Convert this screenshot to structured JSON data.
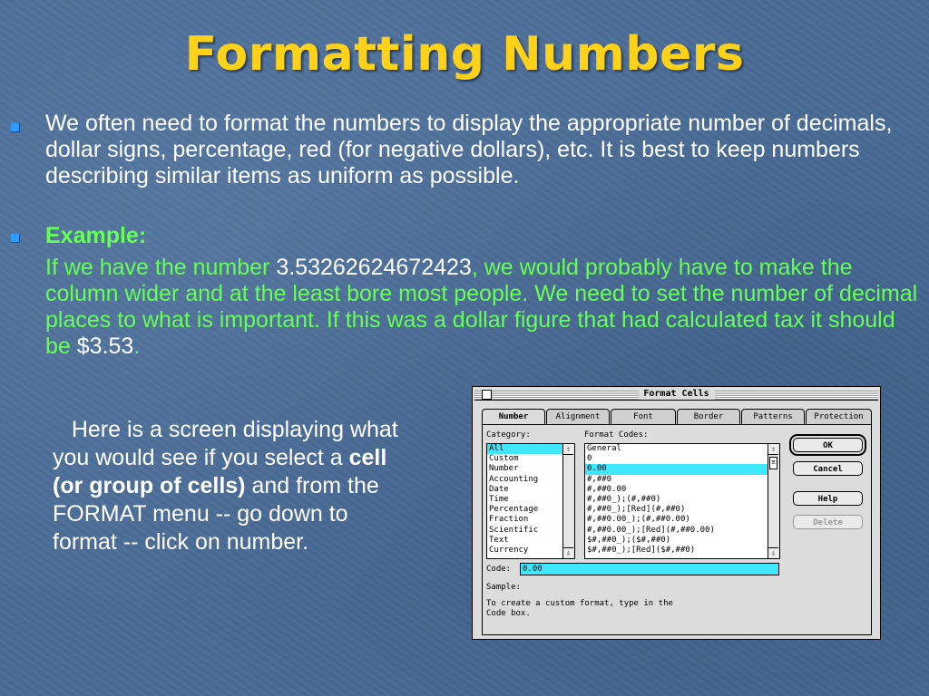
{
  "slide": {
    "title": "Formatting Numbers",
    "bullet1": "We often need to format the numbers to display the appropriate number of decimals, dollar signs, percentage, red (for negative dollars), etc. It is best to keep numbers describing similar items as uniform as possible.",
    "bullet2_heading": "Example:",
    "example": {
      "part1": "If we have the number ",
      "number": "3.53262624672423",
      "part2": ", we would probably have to make the column wider and at the least bore most people. We need to set the number of decimal places to what is important. If this was a dollar figure that had calculated tax it should be ",
      "money": "$3.53",
      "part3": "."
    },
    "caption": {
      "part1": "Here is a screen displaying what you would see if you select a ",
      "bold": "cell (or group of cells)",
      "part2": " and from the FORMAT menu -- go down to format -- click on number."
    },
    "colors": {
      "title": "#ffd21a",
      "green_text": "#66ff55",
      "bullet": "#2f9bff",
      "background": "#4a6c96",
      "highlight": "#3fe8ff"
    }
  },
  "dialog": {
    "title": "Format Cells",
    "tabs": [
      "Number",
      "Alignment",
      "Font",
      "Border",
      "Patterns",
      "Protection"
    ],
    "active_tab": "Number",
    "category_label": "Category:",
    "categories": [
      "All",
      "Custom",
      "Number",
      "Accounting",
      "Date",
      "Time",
      "Percentage",
      "Fraction",
      "Scientific",
      "Text",
      "Currency"
    ],
    "selected_category": "All",
    "format_codes_label": "Format Codes:",
    "format_codes": [
      "General",
      "0",
      "0.00",
      "#,##0",
      "#,##0.00",
      "#,##0_);(#,##0)",
      "#,##0_);[Red](#,##0)",
      "#,##0.00_);(#,##0.00)",
      "#,##0.00_);[Red](#,##0.00)",
      "$#,##0_);($#,##0)",
      "$#,##0_);[Red]($#,##0)"
    ],
    "selected_code": "0.00",
    "code_label": "Code:",
    "code_value": "0.00",
    "sample_label": "Sample:",
    "help_text_line1": "To create a custom format, type in the",
    "help_text_line2": "Code box.",
    "buttons": {
      "ok": "OK",
      "cancel": "Cancel",
      "help": "Help",
      "delete": "Delete"
    }
  }
}
